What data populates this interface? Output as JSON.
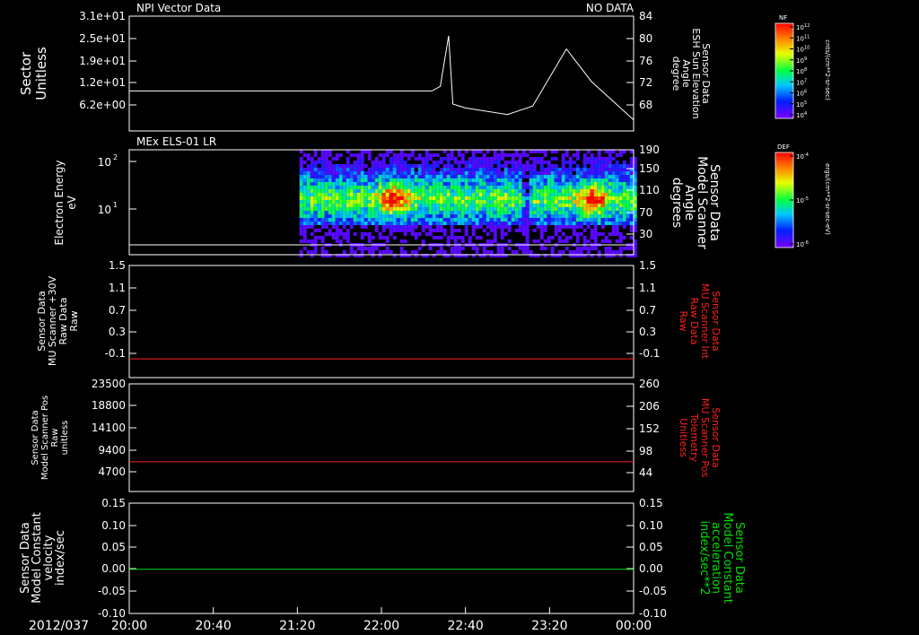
{
  "date_label": "2012/037",
  "x_ticks": [
    "20:00",
    "20:40",
    "21:20",
    "22:00",
    "22:40",
    "23:20",
    "00:00"
  ],
  "colors": {
    "red": "#ff2020",
    "green": "#00e000",
    "white": "#ffffff"
  },
  "panels": [
    {
      "id": "npi",
      "title_left": "NPI Vector Data",
      "title_right": "NO DATA",
      "left_label": [
        "Sector",
        "Unitless"
      ],
      "left_ticks": [
        "3.1e+01",
        "2.5e+01",
        "1.9e+01",
        "1.2e+01",
        "6.2e+00"
      ],
      "right_label": [
        "Sensor Data",
        "ESH Sun Elevation",
        "Angle",
        "degree"
      ],
      "right_ticks": [
        "84",
        "80",
        "76",
        "72",
        "68"
      ]
    },
    {
      "id": "els",
      "title_left": "MEx ELS-01 LR",
      "left_label": [
        "Electron Energy",
        "eV"
      ],
      "left_ticks": [
        "10",
        "10"
      ],
      "left_tick_exponents": [
        "2",
        "1"
      ],
      "right_label": [
        "Sensor Data",
        "Model Scanner",
        "Angle",
        "degrees"
      ],
      "right_ticks": [
        "190",
        "150",
        "110",
        "70",
        "30"
      ]
    },
    {
      "id": "mu30",
      "left_label": [
        "Sensor Data",
        "MU Scanner +30V",
        "Raw Data",
        "Raw"
      ],
      "left_ticks": [
        "1.5",
        "1.1",
        "0.7",
        "0.3",
        "-0.1"
      ],
      "right_label": [
        "Sensor Data",
        "MU Scanner Int",
        "Raw Data",
        "Raw"
      ],
      "right_ticks": [
        "1.5",
        "1.1",
        "0.7",
        "0.3",
        "-0.1"
      ]
    },
    {
      "id": "pos",
      "left_label": [
        "Sensor Data",
        "Model Scanner Pos",
        "Raw",
        "unitless"
      ],
      "left_ticks": [
        "23500",
        "18800",
        "14100",
        "9400",
        "4700"
      ],
      "right_label": [
        "Sensor Data",
        "MU Scanner Pos",
        "Telemetry",
        "Unitless"
      ],
      "right_ticks": [
        "260",
        "206",
        "152",
        "98",
        "44"
      ]
    },
    {
      "id": "vel",
      "left_label": [
        "Sensor Data",
        "Model Constant",
        "velocity",
        "index/sec"
      ],
      "left_ticks": [
        "0.15",
        "0.10",
        "0.05",
        "0.00",
        "-0.05",
        "-0.10"
      ],
      "right_label": [
        "Sensor Data",
        "Model Constant",
        "acceleration",
        "index/sec**2"
      ],
      "right_ticks": [
        "0.15",
        "0.10",
        "0.05",
        "0.00",
        "-0.05",
        "-0.10"
      ]
    }
  ],
  "colorbars": [
    {
      "title": "NF",
      "unit": "cnts/(cm**2-sr-sec)",
      "ticks": [
        "10",
        "10",
        "10",
        "10",
        "10",
        "10",
        "10",
        "10",
        "10"
      ],
      "exponents": [
        "12",
        "11",
        "10",
        "9",
        "8",
        "7",
        "6",
        "5",
        "4"
      ]
    },
    {
      "title": "DEF",
      "unit": "ergs/(cm**2-sr-sec-eV)",
      "ticks": [
        "10",
        "10",
        "10"
      ],
      "exponents": [
        "-4",
        "-5",
        "-6"
      ]
    }
  ],
  "chart_data": [
    {
      "type": "line",
      "panel": "npi",
      "series_label": "ESH Sun Elevation Angle",
      "x": [
        "20:00",
        "21:20",
        "22:00",
        "22:24",
        "22:28",
        "22:32",
        "22:34",
        "22:40",
        "23:00",
        "23:12",
        "23:28",
        "23:40",
        "00:00"
      ],
      "y": [
        72.6,
        72.6,
        72.6,
        72.6,
        73.3,
        81.0,
        70.6,
        70.0,
        69.0,
        70.3,
        79.0,
        74.0,
        68.2
      ],
      "ylim": [
        66.5,
        84
      ]
    },
    {
      "type": "heatmap",
      "panel": "els",
      "x_start": "21:21",
      "x_end": "00:00",
      "energy_range_eV": [
        3,
        200
      ],
      "features": [
        {
          "time": "22:05",
          "energy_eV": 30,
          "level": "high"
        },
        {
          "time": "23:40",
          "energy_eV": 30,
          "level": "high"
        },
        {
          "time": "23:08",
          "description": "narrow gap"
        }
      ],
      "overlay_line_scanner_angle_deg": 30
    },
    {
      "type": "line",
      "panel": "mu30",
      "x": [
        "20:00",
        "00:00"
      ],
      "y": [
        0.0,
        0.0
      ],
      "ylim": [
        -0.3,
        1.5
      ],
      "color": "red"
    },
    {
      "type": "line",
      "panel": "pos",
      "x": [
        "20:00",
        "00:00"
      ],
      "y": [
        7200,
        7200
      ],
      "ylim": [
        1000,
        23500
      ],
      "color": "red"
    },
    {
      "type": "line",
      "panel": "vel",
      "x": [
        "20:00",
        "00:00"
      ],
      "y": [
        0.0,
        0.0
      ],
      "ylim": [
        -0.1,
        0.15
      ],
      "color": "green"
    }
  ]
}
